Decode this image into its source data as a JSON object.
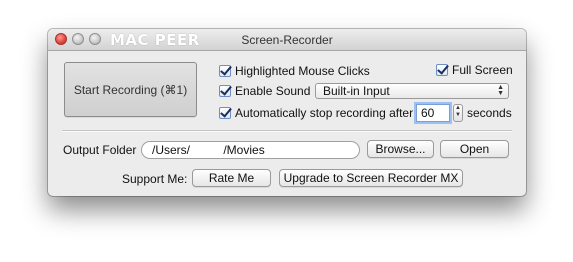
{
  "window": {
    "title": "Screen-Recorder",
    "watermark": "MAC PEER"
  },
  "record": {
    "start_label": "Start Recording (⌘1)"
  },
  "options": {
    "highlight_label": "Highlighted Mouse Clicks",
    "highlight_checked": true,
    "fullscreen_label": "Full Screen",
    "fullscreen_checked": true,
    "sound_label": "Enable Sound",
    "sound_checked": true,
    "sound_source": "Built-in Input",
    "autostop_label": "Automatically stop recording after",
    "autostop_checked": true,
    "autostop_value": "60",
    "autostop_unit": "seconds"
  },
  "output": {
    "label": "Output Folder",
    "path": "/Users/          /Movies",
    "browse_label": "Browse...",
    "open_label": "Open"
  },
  "support": {
    "label": "Support Me:",
    "rate_label": "Rate Me",
    "upgrade_label": "Upgrade to Screen Recorder MX"
  }
}
